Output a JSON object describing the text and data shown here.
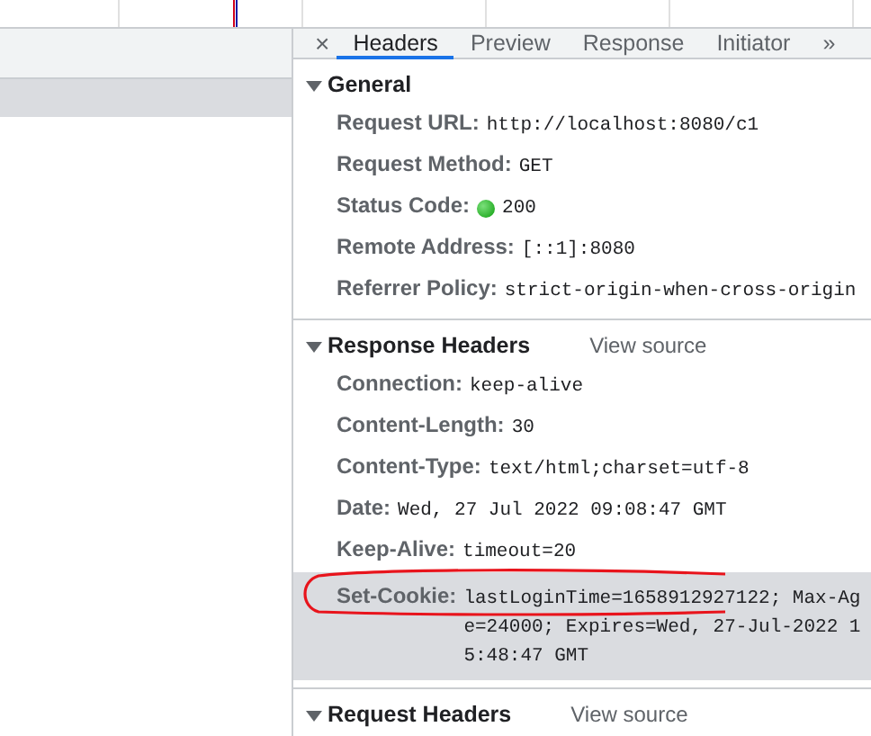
{
  "request_list": {
    "rows": [
      {
        "selected": true
      }
    ]
  },
  "detail": {
    "close": "×",
    "overflow": "»",
    "tabs": [
      {
        "label": "Headers",
        "selected": true
      },
      {
        "label": "Preview",
        "selected": false
      },
      {
        "label": "Response",
        "selected": false
      },
      {
        "label": "Initiator",
        "selected": false
      }
    ],
    "sections": [
      {
        "title": "General",
        "expanded": true,
        "rows": [
          {
            "name": "Request URL:",
            "value": "http://localhost:8080/c1"
          },
          {
            "name": "Request Method:",
            "value": "GET"
          },
          {
            "name": "Status Code:",
            "value": "200",
            "kind": "status"
          },
          {
            "name": "Remote Address:",
            "value": "[::1]:8080"
          },
          {
            "name": "Referrer Policy:",
            "value": "strict-origin-when-cross-origin"
          }
        ]
      },
      {
        "title": "Response Headers",
        "link": "View source",
        "expanded": true,
        "rows": [
          {
            "name": "Connection:",
            "value": "keep-alive"
          },
          {
            "name": "Content-Length:",
            "value": "30"
          },
          {
            "name": "Content-Type:",
            "value": "text/html;charset=utf-8"
          },
          {
            "name": "Date:",
            "value": "Wed, 27 Jul 2022 09:08:47 GMT"
          },
          {
            "name": "Keep-Alive:",
            "value": "timeout=20"
          },
          {
            "name": "Set-Cookie:",
            "value": "lastLoginTime=1658912927122; Max-Age=24000; Expires=Wed, 27-Jul-2022 15:48:47 GMT",
            "kind": "highlight",
            "annotated": true
          }
        ]
      },
      {
        "title": "Request Headers",
        "link": "View source",
        "expanded": true
      }
    ]
  }
}
